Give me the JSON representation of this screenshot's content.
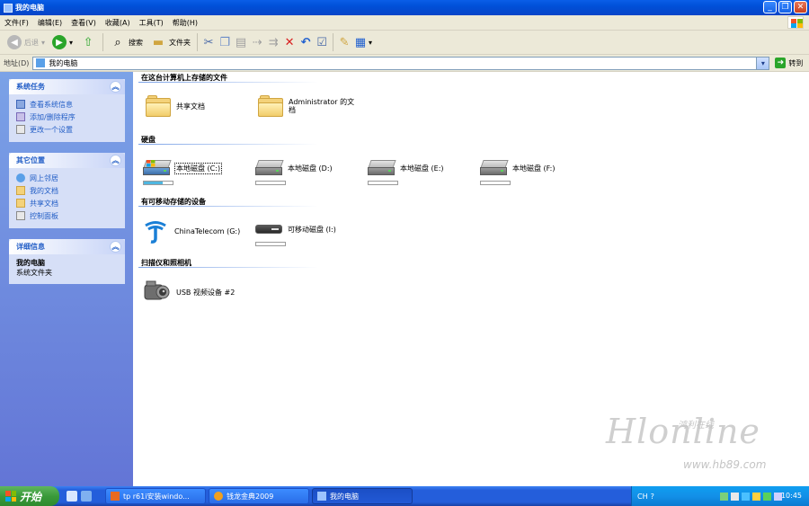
{
  "window": {
    "title": "我的电脑"
  },
  "menu": [
    "文件(F)",
    "编辑(E)",
    "查看(V)",
    "收藏(A)",
    "工具(T)",
    "帮助(H)"
  ],
  "toolbar": {
    "back": "后退",
    "search": "搜索",
    "folders": "文件夹"
  },
  "address": {
    "label": "地址(D)",
    "value": "我的电脑",
    "go": "转到"
  },
  "sidebar": {
    "system_tasks": {
      "title": "系统任务",
      "links": [
        "查看系统信息",
        "添加/删除程序",
        "更改一个设置"
      ]
    },
    "other_places": {
      "title": "其它位置",
      "links": [
        "网上邻居",
        "我的文档",
        "共享文档",
        "控制面板"
      ]
    },
    "details": {
      "title": "详细信息",
      "name": "我的电脑",
      "type": "系统文件夹"
    }
  },
  "groups": {
    "files": {
      "title": "在这台计算机上存储的文件",
      "items": [
        "共享文档",
        "Administrator 的文档"
      ]
    },
    "hard_disks": {
      "title": "硬盘",
      "items": [
        "本地磁盘 (C:)",
        "本地磁盘 (D:)",
        "本地磁盘 (E:)",
        "本地磁盘 (F:)"
      ],
      "usage": [
        0.65,
        0,
        0,
        0
      ]
    },
    "removable": {
      "title": "有可移动存储的设备",
      "items": [
        "ChinaTelecom (G:)",
        "可移动磁盘 (I:)"
      ]
    },
    "scanners": {
      "title": "扫描仪和照相机",
      "items": [
        "USB 视频设备 #2"
      ]
    }
  },
  "watermark": {
    "big": "Hlonline",
    "small": "鸿利在线",
    "url": "www.hb89.com"
  },
  "taskbar": {
    "start": "开始",
    "tasks": [
      "tp r61i安装windo...",
      "钱龙金典2009",
      "我的电脑"
    ],
    "ime": "CH",
    "clock": "10:45"
  },
  "colors": {
    "title_bar": "#0054e3",
    "sidebar": "#6b87d8",
    "taskbar": "#245edb",
    "link": "#215dc6"
  }
}
